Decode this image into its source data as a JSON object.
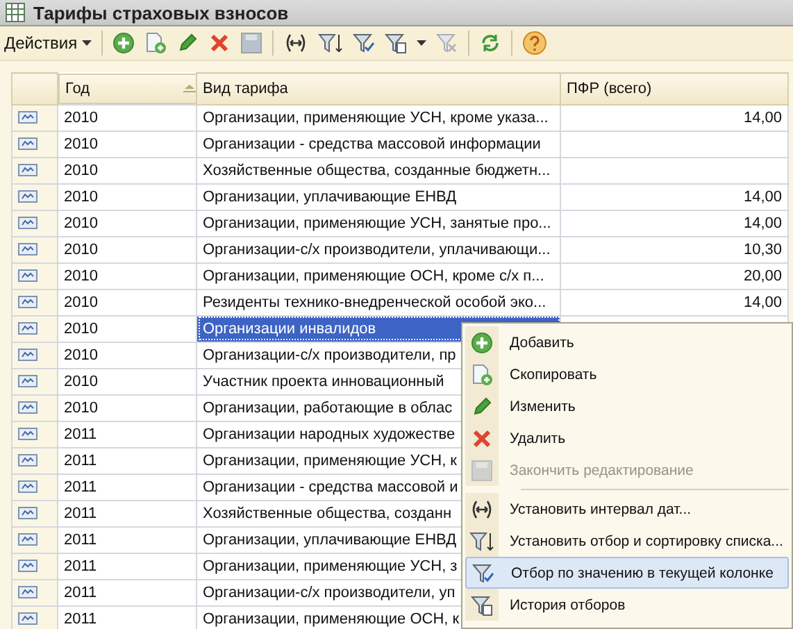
{
  "window": {
    "title": "Тарифы страховых взносов"
  },
  "toolbar": {
    "actions_label": "Действия"
  },
  "table": {
    "columns": [
      "Год",
      "Вид тарифа",
      "ПФР (всего)"
    ],
    "rows": [
      {
        "year": "2010",
        "type": "Организации, применяющие УСН, кроме указа...",
        "pfr": "14,00",
        "selected": false
      },
      {
        "year": "2010",
        "type": "Организации - средства массовой информации",
        "selected": false
      },
      {
        "year": "2010",
        "type": "Хозяйственные общества, созданные бюджетн...",
        "selected": false
      },
      {
        "year": "2010",
        "type": "Организации, уплачивающие ЕНВД",
        "pfr": "14,00",
        "selected": false
      },
      {
        "year": "2010",
        "type": "Организации, применяющие УСН, занятые про...",
        "pfr": "14,00",
        "selected": false
      },
      {
        "year": "2010",
        "type": "Организации-с/х производители, уплачивающи...",
        "pfr": "10,30",
        "selected": false
      },
      {
        "year": "2010",
        "type": "Организации, применяющие ОСН, кроме с/х п...",
        "pfr": "20,00",
        "selected": false
      },
      {
        "year": "2010",
        "type": "Резиденты технико-внедренческой особой эко...",
        "pfr": "14,00",
        "selected": false
      },
      {
        "year": "2010",
        "type": "Организации инвалидов",
        "selected": true
      },
      {
        "year": "2010",
        "type": "Организации-с/х производители, пр",
        "selected": false
      },
      {
        "year": "2010",
        "type": "Участник проекта инновационный",
        "selected": false
      },
      {
        "year": "2010",
        "type": "Организации, работающие в облас",
        "selected": false
      },
      {
        "year": "2011",
        "type": "Организации народных художестве",
        "selected": false
      },
      {
        "year": "2011",
        "type": "Организации, применяющие УСН, к",
        "selected": false
      },
      {
        "year": "2011",
        "type": "Организации - средства массовой и",
        "selected": false
      },
      {
        "year": "2011",
        "type": "Хозяйственные общества, созданн",
        "selected": false
      },
      {
        "year": "2011",
        "type": "Организации, уплачивающие ЕНВД",
        "selected": false
      },
      {
        "year": "2011",
        "type": "Организации, применяющие УСН, з",
        "selected": false
      },
      {
        "year": "2011",
        "type": "Организации-с/х производители, уп",
        "selected": false
      },
      {
        "year": "2011",
        "type": "Организации, применяющие ОСН, к",
        "selected": false
      }
    ]
  },
  "context_menu": {
    "items": [
      {
        "kind": "item",
        "label": "Добавить",
        "disabled": false,
        "selected": false
      },
      {
        "kind": "item",
        "label": "Скопировать",
        "disabled": false,
        "selected": false
      },
      {
        "kind": "item",
        "label": "Изменить",
        "disabled": false,
        "selected": false
      },
      {
        "kind": "item",
        "label": "Удалить",
        "disabled": false,
        "selected": false
      },
      {
        "kind": "item",
        "label": "Закончить редактирование",
        "disabled": true,
        "selected": false
      },
      {
        "kind": "separator"
      },
      {
        "kind": "item",
        "label": "Установить интервал дат...",
        "disabled": false,
        "selected": false
      },
      {
        "kind": "item",
        "label": "Установить отбор и сортировку списка...",
        "disabled": false,
        "selected": false
      },
      {
        "kind": "item",
        "label": "Отбор по значению в текущей колонке",
        "disabled": false,
        "selected": true
      },
      {
        "kind": "item",
        "label": "История отборов",
        "disabled": false,
        "selected": false
      }
    ]
  }
}
